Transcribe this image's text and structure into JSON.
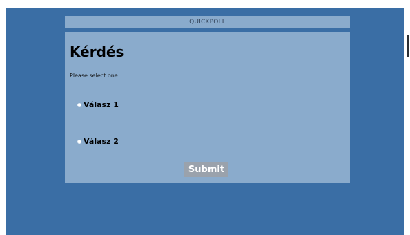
{
  "app": {
    "title": "QUICKPOLL"
  },
  "poll": {
    "question": "Kérdés",
    "prompt": "Please select one:",
    "options": [
      {
        "label": "Válasz 1",
        "selected": false
      },
      {
        "label": "Válasz 2",
        "selected": false
      }
    ],
    "submit_label": "Submit"
  },
  "colors": {
    "page_background": "#3a6ea5",
    "panel": "#8aabcc",
    "submit_button": "#9aa2ac"
  }
}
